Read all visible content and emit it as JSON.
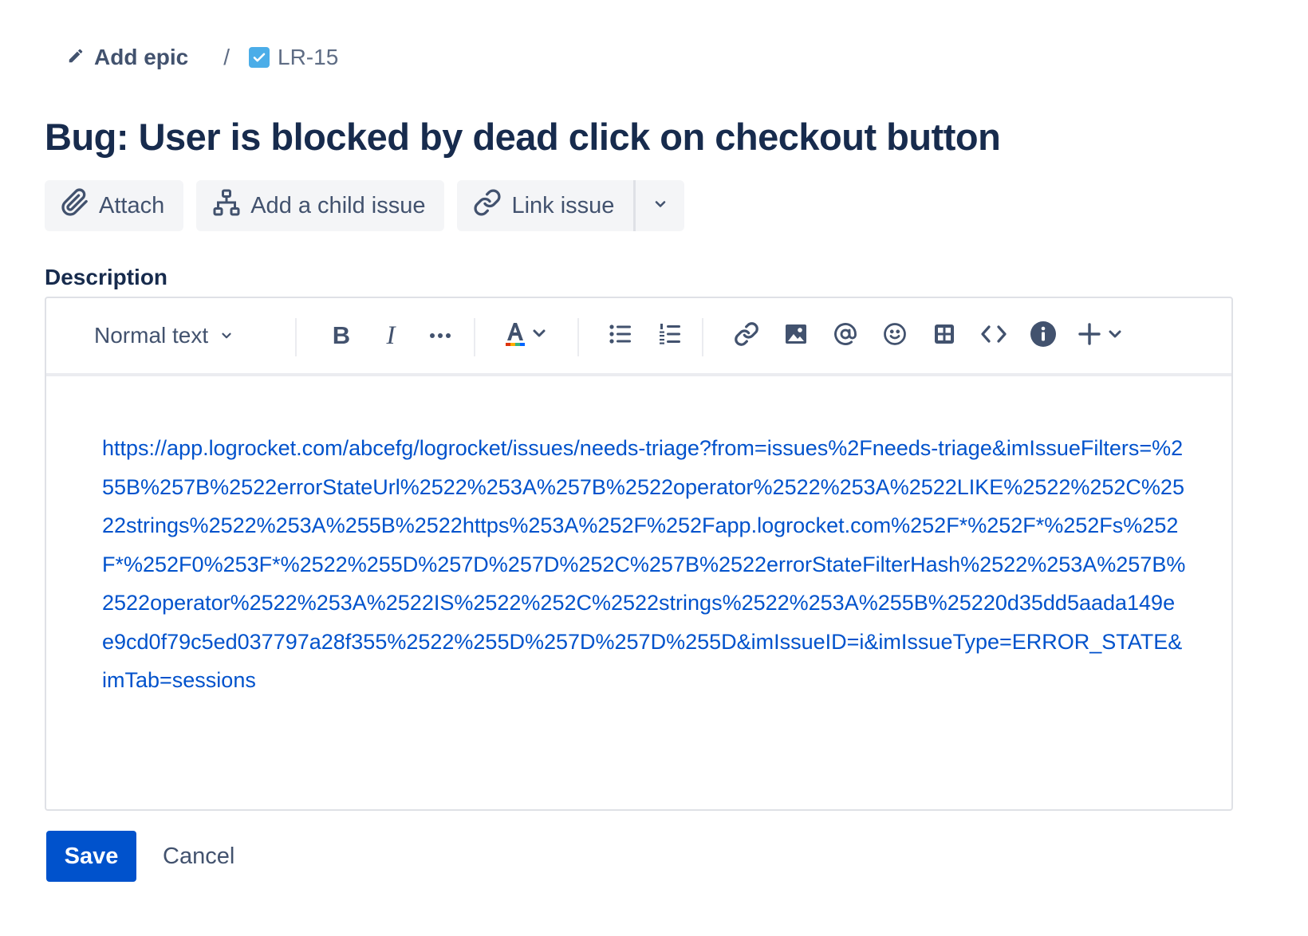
{
  "breadcrumb": {
    "epic_label": "Add epic",
    "separator": "/",
    "issue_key": "LR-15",
    "issue_type_color": "#4bade8"
  },
  "issue": {
    "title": "Bug: User is blocked by dead click on checkout button"
  },
  "actions": {
    "attach": "Attach",
    "add_child": "Add a child issue",
    "link_issue": "Link issue"
  },
  "description": {
    "label": "Description",
    "toolbar": {
      "text_style": "Normal text",
      "bold": "B",
      "italic": "I"
    },
    "link_url": "https://app.logrocket.com/abcefg/logrocket/issues/needs-triage?from=issues%2Fneeds-triage&imIssueFilters=%255B%257B%2522errorStateUrl%2522%253A%257B%2522operator%2522%253A%2522LIKE%2522%252C%2522strings%2522%253A%255B%2522https%253A%252F%252Fapp.logrocket.com%252F*%252F*%252Fs%252F*%252F0%253F*%2522%255D%257D%257D%252C%257B%2522errorStateFilterHash%2522%253A%257B%2522operator%2522%253A%2522IS%2522%252C%2522strings%2522%253A%255B%25220d35dd5aada149ee9cd0f79c5ed037797a28f355%2522%255D%257D%257D%255D&imIssueID=i&imIssueType=ERROR_STATE&imTab=sessions"
  },
  "footer": {
    "save": "Save",
    "cancel": "Cancel"
  },
  "colors": {
    "primary": "#0052cc",
    "text": "#172b4d",
    "subtle": "#42526e"
  }
}
